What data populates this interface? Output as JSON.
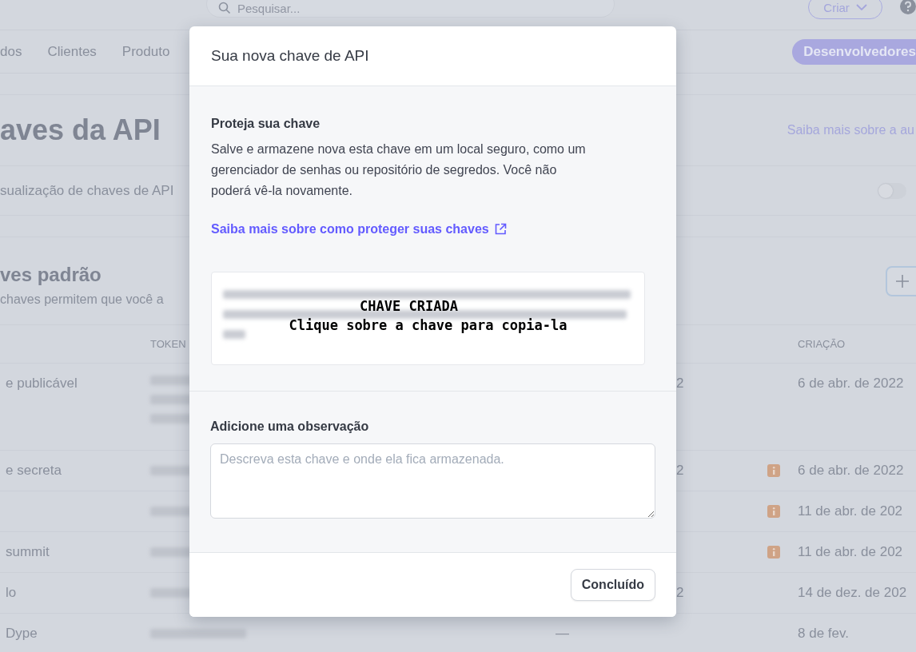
{
  "top_bar": {
    "search": {
      "placeholder": "Pesquisar..."
    },
    "create_button": "Criar"
  },
  "nav": {
    "items": [
      {
        "label": "dos",
        "selected": false
      },
      {
        "label": "Clientes",
        "selected": false
      },
      {
        "label": "Produto",
        "selected": false
      },
      {
        "label": "Desenvolvedores",
        "selected": true
      }
    ]
  },
  "page": {
    "title": "aves da API",
    "docs_link": "Saiba mais sobre a au",
    "preview_label": "sualização de chaves de API",
    "preview_toggle": {
      "on": false
    }
  },
  "standard_keys": {
    "title": "ves padrão",
    "description": "chaves permitem que você a",
    "table": {
      "columns": [
        "TOKEN",
        "CRIAÇÃO"
      ],
      "rows": [
        {
          "name": "e publicável",
          "kind": "multiline",
          "column_3": "2",
          "column_3_covered": true,
          "warning": false,
          "created": "6 de abr. de 2022"
        },
        {
          "name": "e secreta",
          "kind": "single",
          "column_3": "2",
          "column_3_covered": true,
          "warning": true,
          "created": "6 de abr. de 2022"
        },
        {
          "kind": "single",
          "warning": true,
          "created": "11 de abr. de 202"
        },
        {
          "name": "summit",
          "kind": "single",
          "warning": true,
          "created": "11 de abr. de 202"
        },
        {
          "name": "lo",
          "kind": "single",
          "column_3": "2",
          "column_3_covered": true,
          "warning": false,
          "created": "14 de dez. de 202"
        },
        {
          "name": "Dype",
          "kind": "single",
          "column_3": "—",
          "column_3_covered": false,
          "warning": false,
          "created": "8 de fev."
        }
      ]
    }
  },
  "dialog": {
    "title": "Sua nova chave de API",
    "protect_heading": "Proteja sua chave",
    "protect_text": "Salve e armazene nova esta chave em um local seguro, como um gerenciador de senhas ou repositório de segredos. Você não poderá vê-la novamente.",
    "protect_link": "Saiba mais sobre como proteger suas chaves",
    "key_overlay": [
      "CHAVE CRIADA",
      "Clique sobre a chave para copia-la"
    ],
    "note_label": "Adicione uma observação",
    "note_field": {
      "placeholder": "Descreva esta chave e onde ela fica armazenada."
    },
    "done_button": "Concluído"
  }
}
